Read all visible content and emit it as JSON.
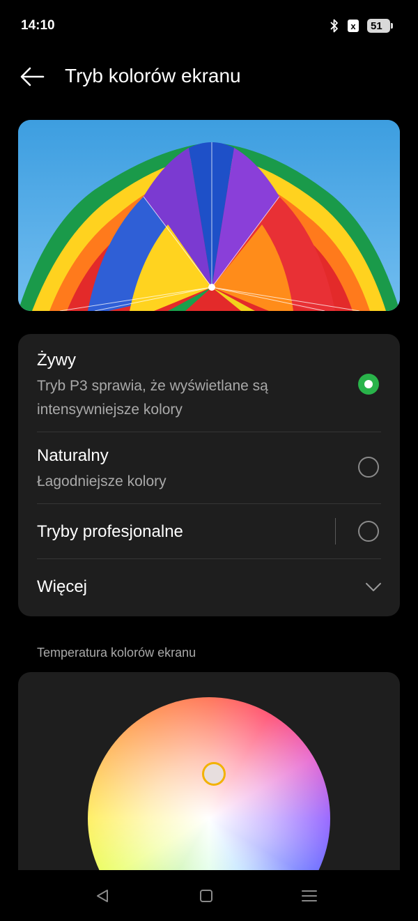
{
  "status_bar": {
    "time": "14:10",
    "sim_label": "x",
    "battery_level": "51"
  },
  "header": {
    "title": "Tryb kolorów ekranu",
    "back_icon": "arrow-left-icon"
  },
  "modes": {
    "items": [
      {
        "title": "Żywy",
        "subtitle_line1": "Tryb P3 sprawia, że wyświetlane są",
        "subtitle_line2": "intensywniejsze kolory",
        "selected": true
      },
      {
        "title": "Naturalny",
        "subtitle_line1": "Łagodniejsze kolory",
        "selected": false
      },
      {
        "title": "Tryby profesjonalne",
        "selected": false
      },
      {
        "title": "Więcej"
      }
    ]
  },
  "temperature": {
    "section_label": "Temperatura kolorów ekranu"
  },
  "colors": {
    "accent_green": "#29b34a",
    "card_bg": "#1e1e1e",
    "handle_ring": "#f2b200"
  },
  "navbar": {
    "icons": [
      "back-triangle-icon",
      "home-square-icon",
      "menu-lines-icon"
    ]
  }
}
